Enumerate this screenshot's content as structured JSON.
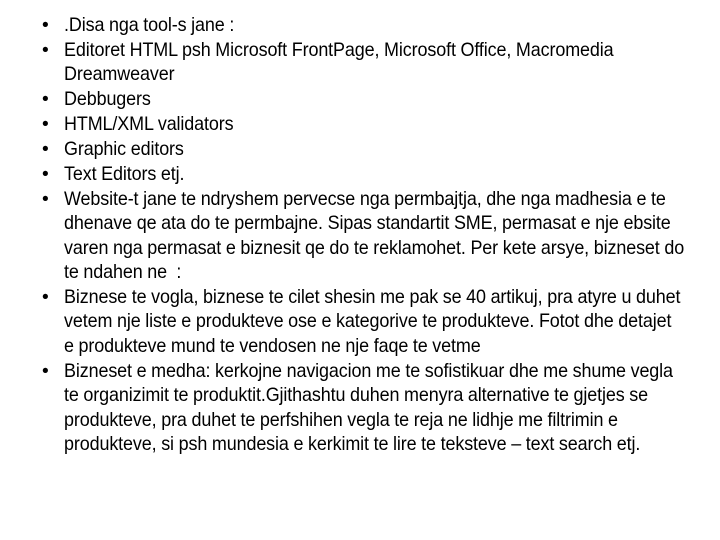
{
  "slide": {
    "background_color": "#ffffff",
    "text_color": "#000000",
    "bullet_glyph": "•",
    "items": [
      {
        "text": ".Disa nga tool-s jane :"
      },
      {
        "text": "Editoret HTML psh Microsoft FrontPage, Microsoft Office, Macromedia Dreamweaver"
      },
      {
        "text": "Debbugers"
      },
      {
        "text": "HTML/XML validators"
      },
      {
        "text": "Graphic editors"
      },
      {
        "text": "Text Editors etj."
      },
      {
        "text": "Website-t jane te ndryshem pervecse nga permbajtja, dhe nga madhesia e te dhenave qe ata do te permbajne. Sipas standartit SME, permasat e nje ebsite varen nga permasat e biznesit qe do te reklamohet. Per kete arsye, bizneset do te ndahen ne  :"
      },
      {
        "text": "Biznese te vogla, biznese te cilet shesin me pak se 40 artikuj, pra atyre u duhet vetem nje liste e produkteve ose e kategorive te produkteve. Fotot dhe detajet e produkteve mund te vendosen ne nje faqe te vetme"
      },
      {
        "text": "Bizneset e medha: kerkojne navigacion me te sofistikuar dhe me shume vegla te organizimit te produktit.Gjithashtu duhen menyra alternative te gjetjes se produkteve, pra duhet te perfshihen vegla te reja ne lidhje me filtrimin e produkteve, si psh mundesia e kerkimit te lire te teksteve – text search etj."
      }
    ]
  }
}
